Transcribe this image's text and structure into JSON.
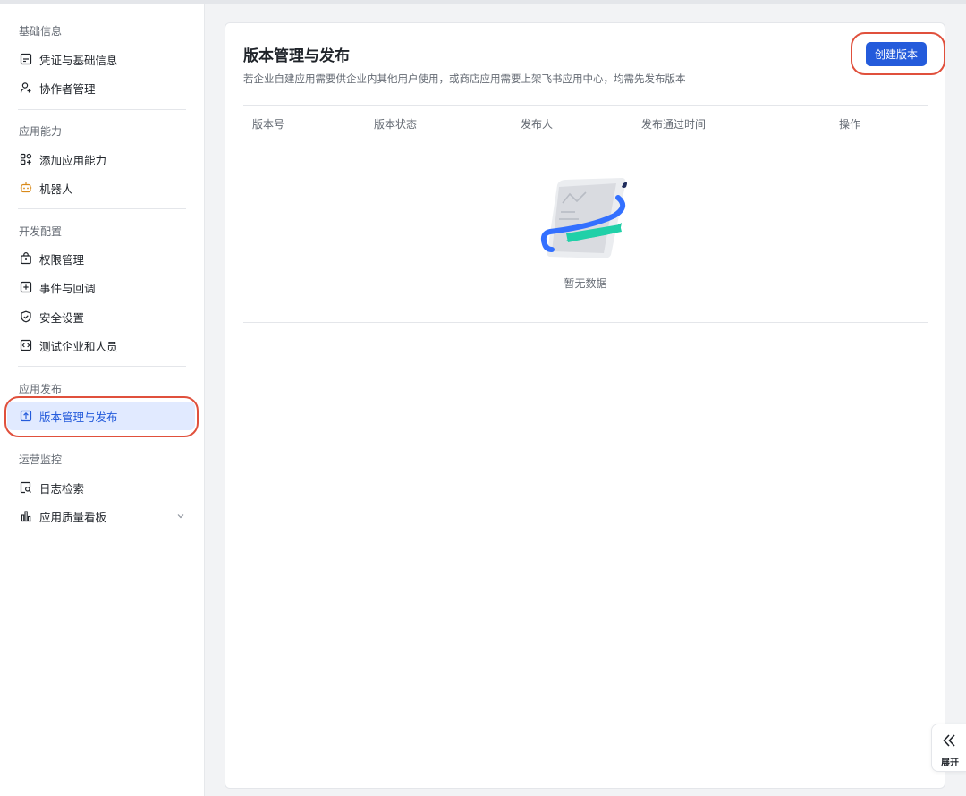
{
  "sidebar": {
    "groups": [
      {
        "title": "基础信息",
        "items": [
          {
            "label": "凭证与基础信息",
            "icon": "credential-card-icon"
          },
          {
            "label": "协作者管理",
            "icon": "add-user-icon"
          }
        ]
      },
      {
        "title": "应用能力",
        "items": [
          {
            "label": "添加应用能力",
            "icon": "app-grid-add-icon"
          },
          {
            "label": "机器人",
            "icon": "robot-icon"
          }
        ]
      },
      {
        "title": "开发配置",
        "items": [
          {
            "label": "权限管理",
            "icon": "lock-permission-icon"
          },
          {
            "label": "事件与回调",
            "icon": "event-callback-icon"
          },
          {
            "label": "安全设置",
            "icon": "shield-check-icon"
          },
          {
            "label": "测试企业和人员",
            "icon": "code-test-icon"
          }
        ]
      },
      {
        "title": "应用发布",
        "items": [
          {
            "label": "版本管理与发布",
            "icon": "upload-version-icon"
          }
        ]
      },
      {
        "title": "运营监控",
        "items": [
          {
            "label": "日志检索",
            "icon": "log-search-icon"
          },
          {
            "label": "应用质量看板",
            "icon": "bar-chart-icon"
          }
        ]
      }
    ]
  },
  "main": {
    "title": "版本管理与发布",
    "description": "若企业自建应用需要供企业内其他用户使用，或商店应用需要上架飞书应用中心，均需先发布版本",
    "create_button": "创建版本",
    "table": {
      "columns": [
        "版本号",
        "版本状态",
        "发布人",
        "发布通过时间",
        "操作"
      ],
      "rows": [],
      "empty_text": "暂无数据"
    }
  },
  "expand_tab": {
    "label": "展开"
  },
  "colors": {
    "accent": "#245bdb",
    "active_bg": "#e1eaff",
    "highlight_ring": "#e0503c"
  }
}
